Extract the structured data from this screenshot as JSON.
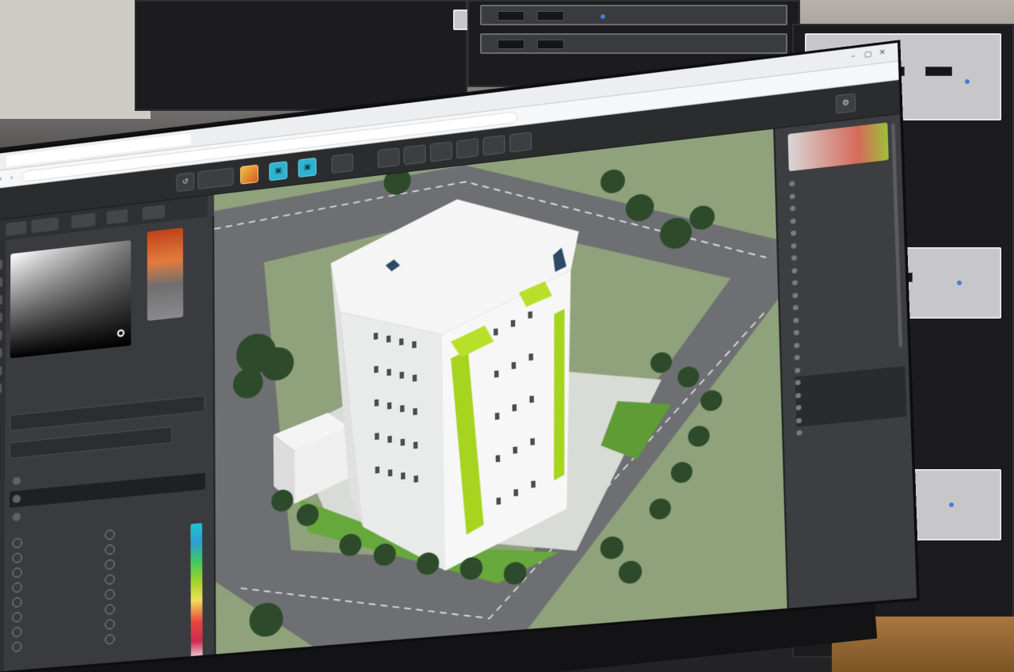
{
  "scene": {
    "caption": "",
    "colors": {
      "accent_cyan": "#2db3cf",
      "accent_lime": "#a6d41f",
      "panel_dark": "#2b2c2e",
      "panel_mid": "#3a3b3e",
      "grass": "#8fa27c",
      "road": "#6e6f72",
      "building": "#f2f2f2"
    }
  },
  "browser": {
    "tab_title": "",
    "url": ""
  },
  "toolbar": {
    "icons": [
      "undo-icon",
      "color-icon",
      "layer-icon",
      "layer-icon",
      "settings-icon"
    ],
    "buttons": [
      "",
      "",
      "",
      "",
      "",
      "",
      "",
      ""
    ]
  },
  "left_panel": {
    "color_name": "",
    "list_left": [
      "",
      "",
      "",
      "",
      "",
      "",
      "",
      ""
    ],
    "list_right": [
      "",
      "",
      "",
      "",
      "",
      "",
      "",
      ""
    ]
  },
  "right_panel": {
    "props": [
      "",
      "",
      "",
      "",
      "",
      "",
      "",
      "",
      "",
      "",
      "",
      "",
      "",
      "",
      "",
      "",
      "",
      "",
      "",
      "",
      ""
    ]
  }
}
